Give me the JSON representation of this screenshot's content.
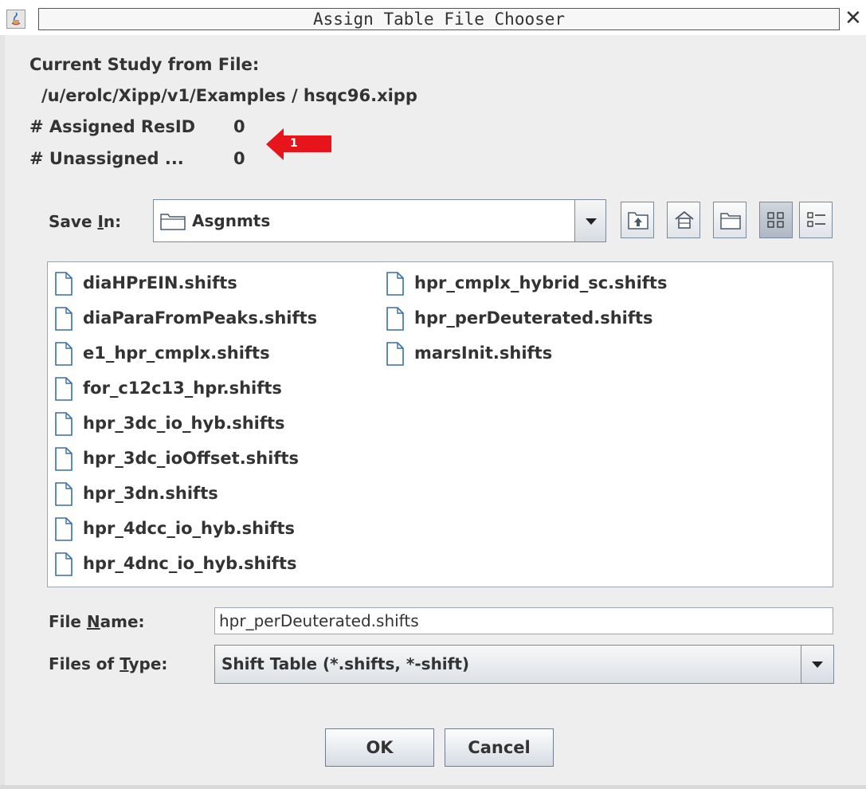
{
  "window": {
    "title": "Assign Table File Chooser",
    "close_glyph": "✕"
  },
  "study": {
    "heading": "Current Study from File:",
    "path": "/u/erolc/Xipp/v1/Examples / hsqc96.xipp",
    "assigned_label": "# Assigned ResID",
    "assigned_value": "0",
    "unassigned_label": "# Unassigned ...",
    "unassigned_value": "0",
    "annotation_badge": "1",
    "annotation_color": "#e8141b"
  },
  "save_in": {
    "label": "Save In:",
    "folder": "Asgnmts",
    "toolbar": [
      "up-one-level-icon",
      "home-icon",
      "new-folder-icon",
      "list-view-icon",
      "details-view-icon"
    ]
  },
  "files": {
    "column1": [
      "diaHPrEIN.shifts",
      "diaParaFromPeaks.shifts",
      "e1_hpr_cmplx.shifts",
      "for_c12c13_hpr.shifts",
      "hpr_3dc_io_hyb.shifts",
      "hpr_3dc_ioOffset.shifts",
      "hpr_3dn.shifts",
      "hpr_4dcc_io_hyb.shifts",
      "hpr_4dnc_io_hyb.shifts"
    ],
    "column2": [
      "hpr_cmplx_hybrid_sc.shifts",
      "hpr_perDeuterated.shifts",
      "marsInit.shifts"
    ]
  },
  "file_name": {
    "label": "File Name:",
    "value": "hpr_perDeuterated.shifts"
  },
  "file_type": {
    "label": "Files of Type:",
    "value": "Shift Table (*.shifts, *-shift)"
  },
  "buttons": {
    "ok": "OK",
    "cancel": "Cancel"
  }
}
